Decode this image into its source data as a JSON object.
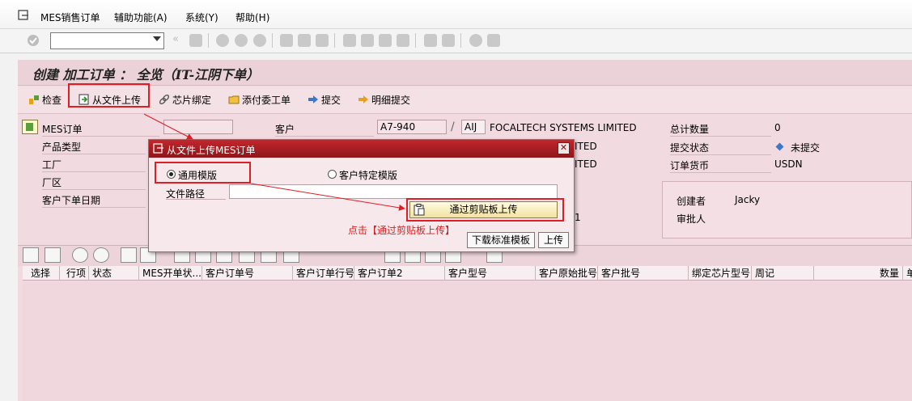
{
  "menubar": {
    "items": [
      {
        "label": "MES销售订单"
      },
      {
        "label": "辅助功能(A)"
      },
      {
        "label": "系统(Y)"
      },
      {
        "label": "帮助(H)"
      }
    ]
  },
  "page": {
    "title": "创建 加工订单 ： 全览（IT-江阴下单）"
  },
  "app_toolbar": {
    "buttons": [
      {
        "label": "检查",
        "icon": "check-icon"
      },
      {
        "label": "从文件上传",
        "icon": "upload-file-icon"
      },
      {
        "label": "芯片绑定",
        "icon": "link-icon"
      },
      {
        "label": "添付委工单",
        "icon": "folder-icon"
      },
      {
        "label": "提交",
        "icon": "arrow-right-icon"
      },
      {
        "label": "明细提交",
        "icon": "arrow-detail-icon"
      }
    ]
  },
  "header_fields": {
    "mes_order_label": "MES订单",
    "product_type_label": "产品类型",
    "factory_label": "工厂",
    "plant_area_label": "厂区",
    "order_date_label": "客户下单日期",
    "customer_label": "客户",
    "customer_code": "A7-940",
    "customer_abbr": "AIJ",
    "customer_name": "FOCALTECH SYSTEMS LIMITED",
    "row2_partial": "ITED",
    "row3_partial": "ITED",
    "row5_partial": "1",
    "total_qty_label": "总计数量",
    "total_qty_value": "0",
    "submit_status_label": "提交状态",
    "submit_status_value": "未提交",
    "currency_label": "订单货币",
    "currency_value": "USDN",
    "creator_label": "创建者",
    "creator_value": "Jacky",
    "approver_label": "审批人"
  },
  "grid": {
    "columns": [
      "选择",
      "行项",
      "状态",
      "MES开单状...",
      "客户订单号",
      "客户订单行号",
      "客户订单2",
      "客户型号",
      "客户原始批号",
      "客户批号",
      "绑定芯片型号",
      "周记",
      "数量",
      "单"
    ]
  },
  "dialog": {
    "title": "从文件上传MES订单",
    "radio_generic": "通用模版",
    "radio_customer": "客户特定模版",
    "path_label": "文件路径",
    "path_value": "",
    "clipboard_button": "通过剪贴板上传",
    "hint": "点击【通过剪贴板上传】",
    "download_button": "下载标准模板",
    "upload_button": "上传",
    "selected_radio": "generic"
  },
  "colors": {
    "dialog_title": "#b01e24",
    "highlight": "#e01c24",
    "panel_bg": "#f1dbe1"
  }
}
